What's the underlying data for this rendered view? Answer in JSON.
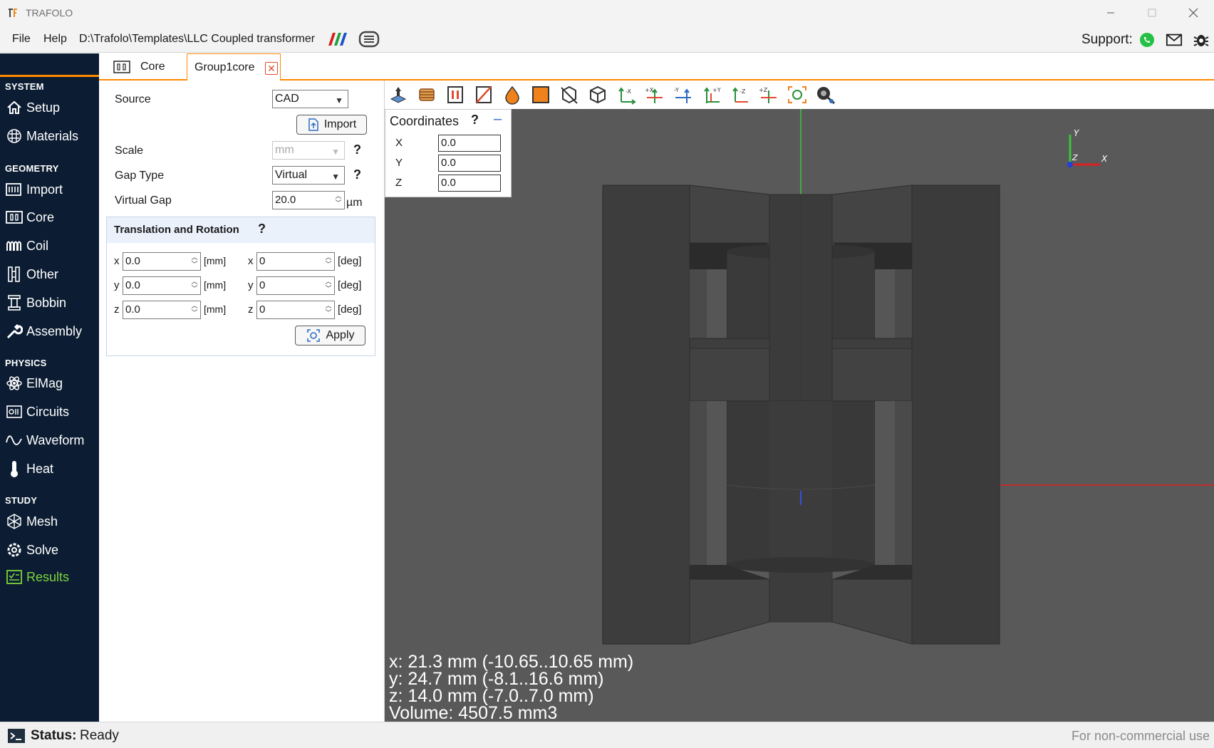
{
  "window": {
    "title": "TRAFOLO"
  },
  "menu": {
    "file": "File",
    "help": "Help",
    "path": "D:\\Trafolo\\Templates\\LLC Coupled transformer",
    "support": "Support:"
  },
  "sidebar": {
    "sections": {
      "system": "SYSTEM",
      "geometry": "GEOMETRY",
      "physics": "PHYSICS",
      "study": "STUDY"
    },
    "items": {
      "setup": "Setup",
      "materials": "Materials",
      "import": "Import",
      "core": "Core",
      "coil": "Coil",
      "other": "Other",
      "bobbin": "Bobbin",
      "assembly": "Assembly",
      "elmag": "ElMag",
      "circuits": "Circuits",
      "waveform": "Waveform",
      "heat": "Heat",
      "mesh": "Mesh",
      "solve": "Solve",
      "results": "Results"
    }
  },
  "tabs": {
    "core": "Core",
    "group": "Group1core",
    "close": "✕"
  },
  "props": {
    "source_label": "Source",
    "source_value": "CAD",
    "import_button": "Import",
    "scale_label": "Scale",
    "scale_value": "mm",
    "gap_type_label": "Gap Type",
    "gap_type_value": "Virtual",
    "virtual_gap_label": "Virtual Gap",
    "virtual_gap_value": "20.0",
    "virtual_gap_unit": "µm",
    "help": "?"
  },
  "transform": {
    "title": "Translation and Rotation",
    "help": "?",
    "axes": [
      "x",
      "y",
      "z"
    ],
    "translation": [
      "0.0",
      "0.0",
      "0.0"
    ],
    "rotation": [
      "0",
      "0",
      "0"
    ],
    "t_unit": "[mm]",
    "r_unit": "[deg]",
    "apply": "Apply"
  },
  "coordinates": {
    "title": "Coordinates",
    "help": "?",
    "minimize": "–",
    "labels": [
      "X",
      "Y",
      "Z"
    ],
    "values": [
      "0.0",
      "0.0",
      "0.0"
    ]
  },
  "dimensions": [
    "x: 21.3 mm (-10.65..10.65 mm)",
    "y: 24.7 mm (-8.1..16.6 mm)",
    "z: 14.0 mm (-7.0..7.0 mm)",
    "Volume: 4507.5 mm3"
  ],
  "triad": {
    "x": "X",
    "y": "Y",
    "z": "Z"
  },
  "status": {
    "label": "Status:",
    "value": "Ready",
    "right": "For non-commercial use"
  },
  "colors": {
    "sidebar_bg": "#0c1d33",
    "accent": "#ff8a00",
    "results": "#7dd33b",
    "viewport_bg": "#595959"
  }
}
